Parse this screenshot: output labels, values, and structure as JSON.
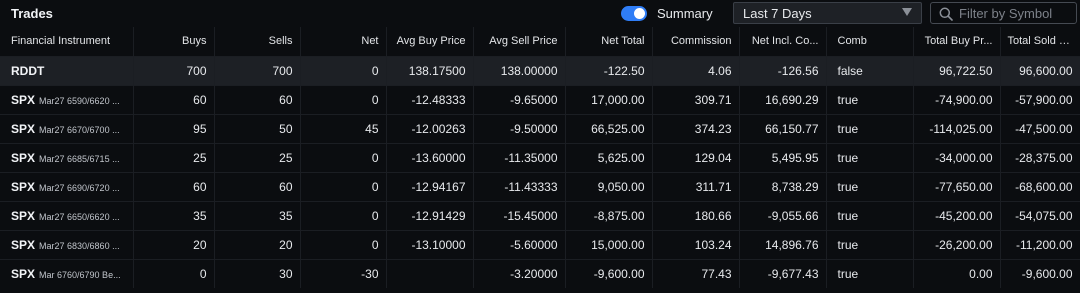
{
  "header": {
    "title": "Trades",
    "summary_label": "Summary",
    "summary_on": true,
    "period": "Last 7 Days",
    "search_placeholder": "Filter by Symbol"
  },
  "colors": {
    "accent": "#2f7df6",
    "background": "#0b0d10",
    "selected_row": "#1d2025"
  },
  "columns": [
    "Financial Instrument",
    "Buys",
    "Sells",
    "Net",
    "Avg Buy Price",
    "Avg Sell Price",
    "Net Total",
    "Commission",
    "Net Incl. Co...",
    "Comb",
    "Total Buy Pr...",
    "Total Sold P..."
  ],
  "rows": [
    {
      "symbol": "RDDT",
      "desc": "",
      "buys": "700",
      "sells": "700",
      "net": "0",
      "avg_buy": "138.17500",
      "avg_sell": "138.00000",
      "net_total": "-122.50",
      "commission": "4.06",
      "net_incl": "-126.56",
      "comb": "false",
      "total_buy": "96,722.50",
      "total_sold": "96,600.00"
    },
    {
      "symbol": "SPX",
      "desc": "Mar27 6590/6620 ...",
      "buys": "60",
      "sells": "60",
      "net": "0",
      "avg_buy": "-12.48333",
      "avg_sell": "-9.65000",
      "net_total": "17,000.00",
      "commission": "309.71",
      "net_incl": "16,690.29",
      "comb": "true",
      "total_buy": "-74,900.00",
      "total_sold": "-57,900.00"
    },
    {
      "symbol": "SPX",
      "desc": "Mar27 6670/6700 ...",
      "buys": "95",
      "sells": "50",
      "net": "45",
      "avg_buy": "-12.00263",
      "avg_sell": "-9.50000",
      "net_total": "66,525.00",
      "commission": "374.23",
      "net_incl": "66,150.77",
      "comb": "true",
      "total_buy": "-114,025.00",
      "total_sold": "-47,500.00"
    },
    {
      "symbol": "SPX",
      "desc": "Mar27 6685/6715 ...",
      "buys": "25",
      "sells": "25",
      "net": "0",
      "avg_buy": "-13.60000",
      "avg_sell": "-11.35000",
      "net_total": "5,625.00",
      "commission": "129.04",
      "net_incl": "5,495.95",
      "comb": "true",
      "total_buy": "-34,000.00",
      "total_sold": "-28,375.00"
    },
    {
      "symbol": "SPX",
      "desc": "Mar27 6690/6720 ...",
      "buys": "60",
      "sells": "60",
      "net": "0",
      "avg_buy": "-12.94167",
      "avg_sell": "-11.43333",
      "net_total": "9,050.00",
      "commission": "311.71",
      "net_incl": "8,738.29",
      "comb": "true",
      "total_buy": "-77,650.00",
      "total_sold": "-68,600.00"
    },
    {
      "symbol": "SPX",
      "desc": "Mar27 6650/6620 ...",
      "buys": "35",
      "sells": "35",
      "net": "0",
      "avg_buy": "-12.91429",
      "avg_sell": "-15.45000",
      "net_total": "-8,875.00",
      "commission": "180.66",
      "net_incl": "-9,055.66",
      "comb": "true",
      "total_buy": "-45,200.00",
      "total_sold": "-54,075.00"
    },
    {
      "symbol": "SPX",
      "desc": "Mar27 6830/6860 ...",
      "buys": "20",
      "sells": "20",
      "net": "0",
      "avg_buy": "-13.10000",
      "avg_sell": "-5.60000",
      "net_total": "15,000.00",
      "commission": "103.24",
      "net_incl": "14,896.76",
      "comb": "true",
      "total_buy": "-26,200.00",
      "total_sold": "-11,200.00"
    },
    {
      "symbol": "SPX",
      "desc": "Mar 6760/6790 Be...",
      "buys": "0",
      "sells": "30",
      "net": "-30",
      "avg_buy": "",
      "avg_sell": "-3.20000",
      "net_total": "-9,600.00",
      "commission": "77.43",
      "net_incl": "-9,677.43",
      "comb": "true",
      "total_buy": "0.00",
      "total_sold": "-9,600.00"
    }
  ]
}
